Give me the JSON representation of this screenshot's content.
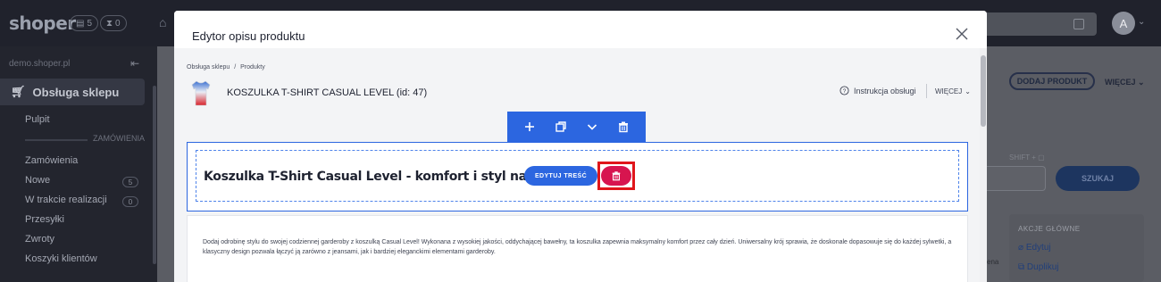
{
  "app": {
    "logo": "shoper",
    "header_badges": [
      "5",
      "0"
    ],
    "avatar_letter": "A"
  },
  "sidebar": {
    "domain": "demo.shoper.pl",
    "section": "Obsługa sklepu",
    "divider_label": "ZAMÓWIENIA",
    "items": [
      {
        "label": "Pulpit"
      },
      {
        "label": "Zamówienia"
      },
      {
        "label": "Nowe",
        "count": "5"
      },
      {
        "label": "W trakcie realizacji",
        "count": "0"
      },
      {
        "label": "Przesyłki"
      },
      {
        "label": "Zwroty"
      },
      {
        "label": "Koszyki klientów"
      }
    ]
  },
  "background": {
    "add_product": "DODAJ PRODUKT",
    "more": "WIĘCEJ",
    "shift_hint": "SHIFT +",
    "search_button": "SZUKAJ",
    "actions_title": "AKCJE GŁÓWNE",
    "actions": [
      "Edytuj",
      "Duplikuj"
    ],
    "partial_text": "ena"
  },
  "modal": {
    "title": "Edytor opisu produktu",
    "breadcrumb": [
      "Obsługa sklepu",
      "Produkty"
    ],
    "breadcrumb_sep": "/",
    "product_title": "KOSZULKA T-SHIRT CASUAL LEVEL (id: 47)",
    "help_link": "Instrukcja obsługi",
    "more_link": "WIĘCEJ",
    "block": {
      "heading": "Koszulka T-Shirt Casual Level - komfort i styl na co dzień",
      "edit_button": "EDYTUJ TREŚĆ"
    },
    "paragraph": "Dodaj odrobinę stylu do swojej codziennej garderoby z koszulką Casual Level! Wykonana z wysokiej jakości, oddychającej bawełny, ta koszulka zapewnia maksymalny komfort przez cały dzień. Uniwersalny krój sprawia, że doskonale dopasowuje się do każdej sylwetki, a klasyczny design pozwala łączyć ją zarówno z jeansami, jak i bardziej eleganckimi elementami garderoby."
  },
  "colors": {
    "primary": "#2c66e0",
    "danger": "#d7154f",
    "highlight": "#e0161b",
    "sidebar": "#23252e",
    "topbar": "#20222c"
  }
}
